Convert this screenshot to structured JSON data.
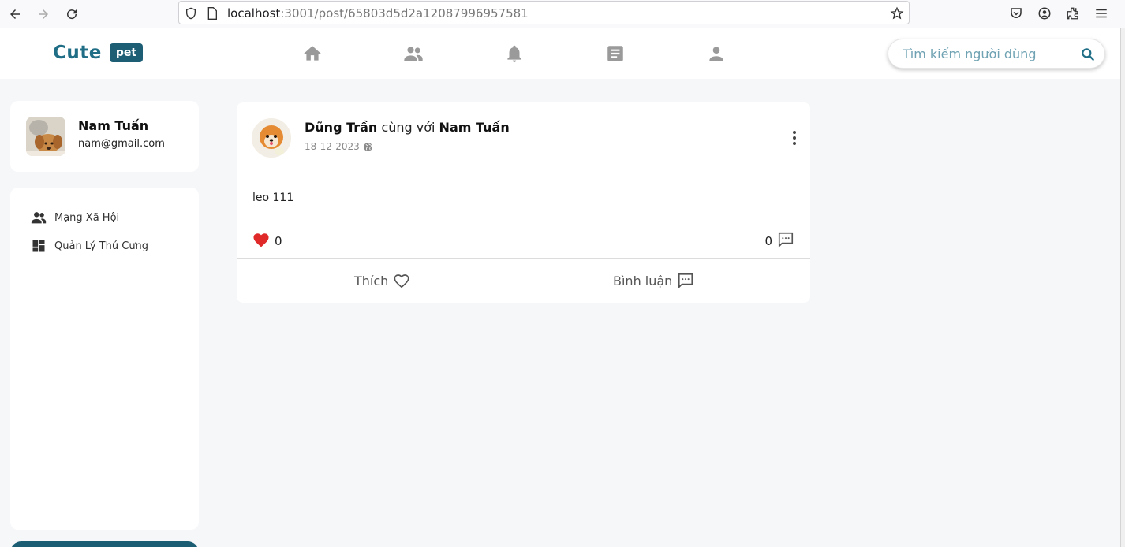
{
  "browser": {
    "url_host": "localhost",
    "url_path": ":3001/post/65803d5d2a12087996957581"
  },
  "header": {
    "logo_text": "Cute",
    "logo_badge": "pet",
    "nav_icons": [
      "home-icon",
      "friends-icon",
      "bell-icon",
      "article-icon",
      "person-icon"
    ],
    "search_placeholder": "Tìm kiếm người dùng"
  },
  "profile": {
    "name": "Nam Tuấn",
    "email": "nam@gmail.com"
  },
  "menu": {
    "items": [
      {
        "label": "Mạng Xã Hội",
        "icon": "group-icon"
      },
      {
        "label": "Quản Lý Thú Cưng",
        "icon": "dashboard-icon"
      }
    ]
  },
  "post": {
    "author": "Dũng Trần",
    "with_text": "cùng với",
    "tagged": "Nam Tuấn",
    "date": "18-12-2023",
    "visibility_icon": "globe-icon",
    "content": "leo 111",
    "like_count": "0",
    "comment_count": "0",
    "like_label": "Thích",
    "comment_label": "Bình luận"
  },
  "colors": {
    "brand": "#1f6e86",
    "brand_dark": "#1d5e75",
    "heart": "#e02a2a",
    "nav_icon": "#9a9a9a"
  }
}
